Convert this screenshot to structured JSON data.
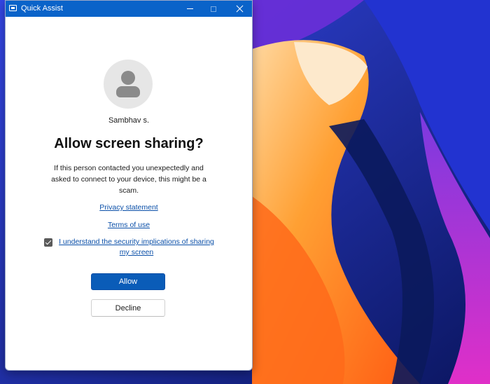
{
  "window": {
    "title": "Quick Assist",
    "accent_color": "#0a63c9"
  },
  "dialog": {
    "user_name": "Sambhav s.",
    "headline": "Allow screen sharing?",
    "warning": "If this person contacted you unexpectedly and asked to connect to your device, this might be a scam.",
    "privacy_link": "Privacy statement",
    "terms_link": "Terms of use",
    "consent_label": "I understand the security implications of sharing my screen",
    "consent_checked": true,
    "allow_label": "Allow",
    "decline_label": "Decline"
  },
  "icons": {
    "app": "quick-assist-icon",
    "minimize": "minimize-icon",
    "maximize": "maximize-icon",
    "close": "close-icon",
    "avatar": "person-icon",
    "checkbox": "checkmark-icon"
  }
}
